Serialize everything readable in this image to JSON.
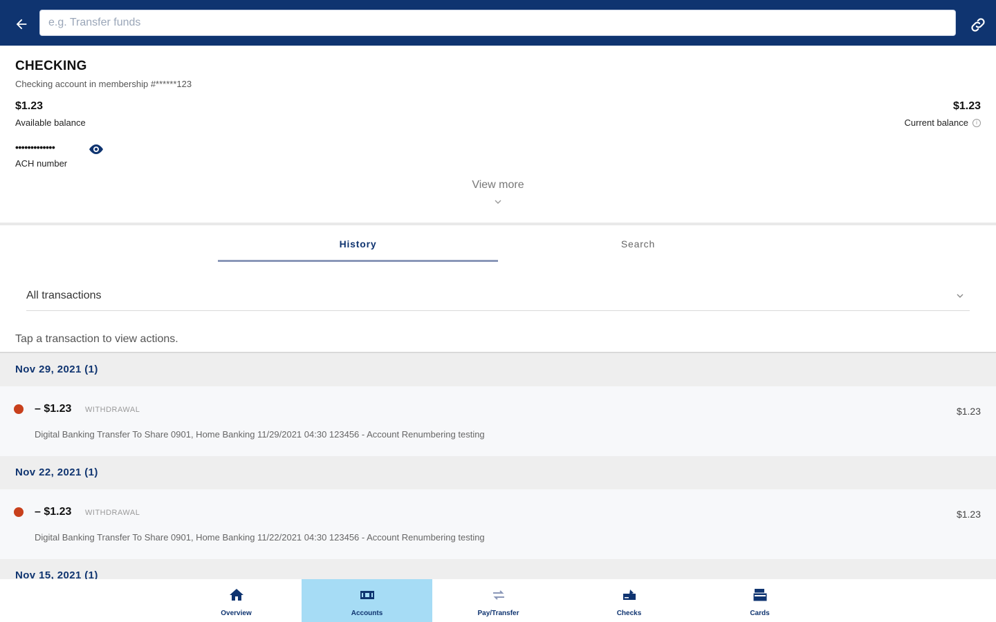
{
  "topbar": {
    "search_placeholder": "e.g. Transfer funds",
    "back_icon": "arrow-left-icon",
    "link_icon": "link-icon"
  },
  "account": {
    "title": "CHECKING",
    "subtitle": "Checking account in membership #******123",
    "available_balance": "$1.23",
    "available_label": "Available balance",
    "current_balance": "$1.23",
    "current_label": "Current balance",
    "ach_masked": "•••••••••••••",
    "ach_label": "ACH number",
    "view_more": "View more"
  },
  "tabs": [
    {
      "label": "History",
      "active": true
    },
    {
      "label": "Search",
      "active": false
    }
  ],
  "filter": {
    "selected": "All transactions"
  },
  "hint": "Tap a transaction to view actions.",
  "groups": [
    {
      "date": "Nov 29, 2021 (1)",
      "transactions": [
        {
          "amount": "– $1.23",
          "type": "WITHDRAWAL",
          "description": "Digital Banking Transfer To Share 0901, Home Banking 11/29/2021 04:30 123456 - Account Renumbering testing",
          "balance": "$1.23"
        }
      ]
    },
    {
      "date": "Nov 22, 2021 (1)",
      "transactions": [
        {
          "amount": "– $1.23",
          "type": "WITHDRAWAL",
          "description": "Digital Banking Transfer To Share 0901, Home Banking 11/22/2021 04:30 123456 - Account Renumbering testing",
          "balance": "$1.23"
        }
      ]
    },
    {
      "date": "Nov 15, 2021 (1)",
      "transactions": []
    }
  ],
  "bottom_nav": [
    {
      "label": "Overview",
      "icon": "home-icon",
      "active": false
    },
    {
      "label": "Accounts",
      "icon": "accounts-icon",
      "active": true
    },
    {
      "label": "Pay/Transfer",
      "icon": "transfer-icon",
      "active": false
    },
    {
      "label": "Checks",
      "icon": "checks-icon",
      "active": false
    },
    {
      "label": "Cards",
      "icon": "cards-icon",
      "active": false
    }
  ],
  "colors": {
    "brand": "#0f3470",
    "active_nav": "#a6dcf5",
    "withdrawal_dot": "#c8401c"
  }
}
